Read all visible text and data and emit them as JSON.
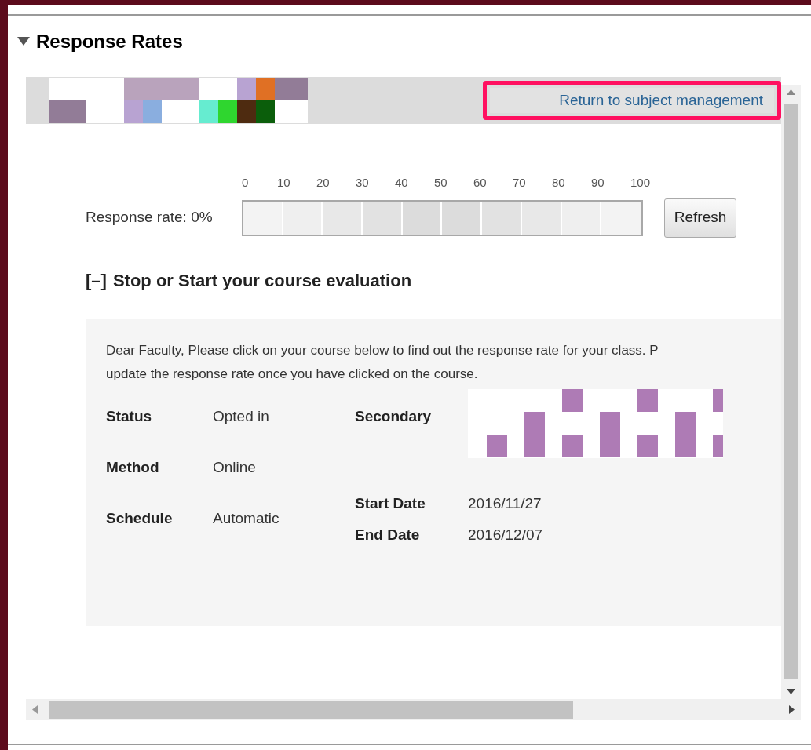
{
  "section": {
    "title": "Response Rates",
    "expanded": true
  },
  "toolbar": {
    "return_button": "Return to subject management"
  },
  "response": {
    "label": "Response rate: 0%",
    "level": 0,
    "ticks": [
      "0",
      "10",
      "20",
      "30",
      "40",
      "50",
      "60",
      "70",
      "80",
      "90",
      "100"
    ],
    "refresh_button": "Refresh"
  },
  "evaluation": {
    "toggle": "[–]",
    "title": "Stop or Start your course evaluation",
    "message": "Dear Faculty, Please click on your course below to find out the response rate for your class. P\nupdate the response rate once you have clicked on the course.",
    "left_fields": [
      {
        "label": "Status",
        "value": "Opted in"
      },
      {
        "label": "Method",
        "value": "Online"
      },
      {
        "label": "Schedule",
        "value": "Automatic"
      }
    ],
    "right_fields": [
      {
        "kind": "image",
        "label": "Secondary"
      },
      {
        "kind": "text",
        "label": "Start Date",
        "value": "2016/11/27"
      },
      {
        "kind": "text",
        "label": "End Date",
        "value": "2016/12/07"
      }
    ]
  }
}
